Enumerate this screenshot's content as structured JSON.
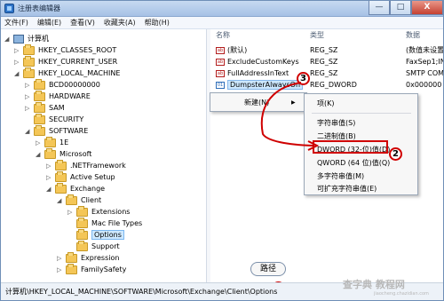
{
  "window": {
    "title": "注册表编辑器",
    "buttons": [
      "—",
      "□",
      "X"
    ]
  },
  "menus": [
    "文件(F)",
    "编辑(E)",
    "查看(V)",
    "收藏夹(A)",
    "帮助(H)"
  ],
  "tree": [
    "计算机",
    "HKEY_CLASSES_ROOT",
    "HKEY_CURRENT_USER",
    "HKEY_LOCAL_MACHINE",
    "BCD00000000",
    "HARDWARE",
    "SAM",
    "SECURITY",
    "SOFTWARE",
    "1E",
    "Microsoft",
    ".NETFramework",
    "Active Setup",
    "Exchange",
    "Client",
    "Extensions",
    "Mac File Types",
    "Options",
    "Support",
    "Expression",
    "FamilySafety"
  ],
  "columns": [
    "名称",
    "类型",
    "数据"
  ],
  "values": [
    {
      "name": "(默认)",
      "type": "REG_SZ",
      "data": "(数值未设置)"
    },
    {
      "name": "ExcludeCustomKeys",
      "type": "REG_SZ",
      "data": "FaxSep1;IN"
    },
    {
      "name": "FullAddressInText",
      "type": "REG_SZ",
      "data": "SMTP COM"
    },
    {
      "name": "DumpsterAlwaysOn",
      "type": "REG_DWORD",
      "data": "0x000000"
    }
  ],
  "context_menu": {
    "new": "新建(N)",
    "arrow": "▶"
  },
  "submenu": [
    "项(K)",
    "字符串值(S)",
    "二进制值(B)",
    "DWORD (32-位)值(D)",
    "QWORD (64 位)值(Q)",
    "多字符串值(M)",
    "可扩充字符串值(E)"
  ],
  "status_path": "计算机\\HKEY_LOCAL_MACHINE\\SOFTWARE\\Microsoft\\Exchange\\Client\\Options",
  "callouts": [
    "1",
    "2",
    "3"
  ],
  "path_label": "路径",
  "watermark": "查字典 教程网",
  "watermark_url": "jiaocheng.chazidian.com"
}
